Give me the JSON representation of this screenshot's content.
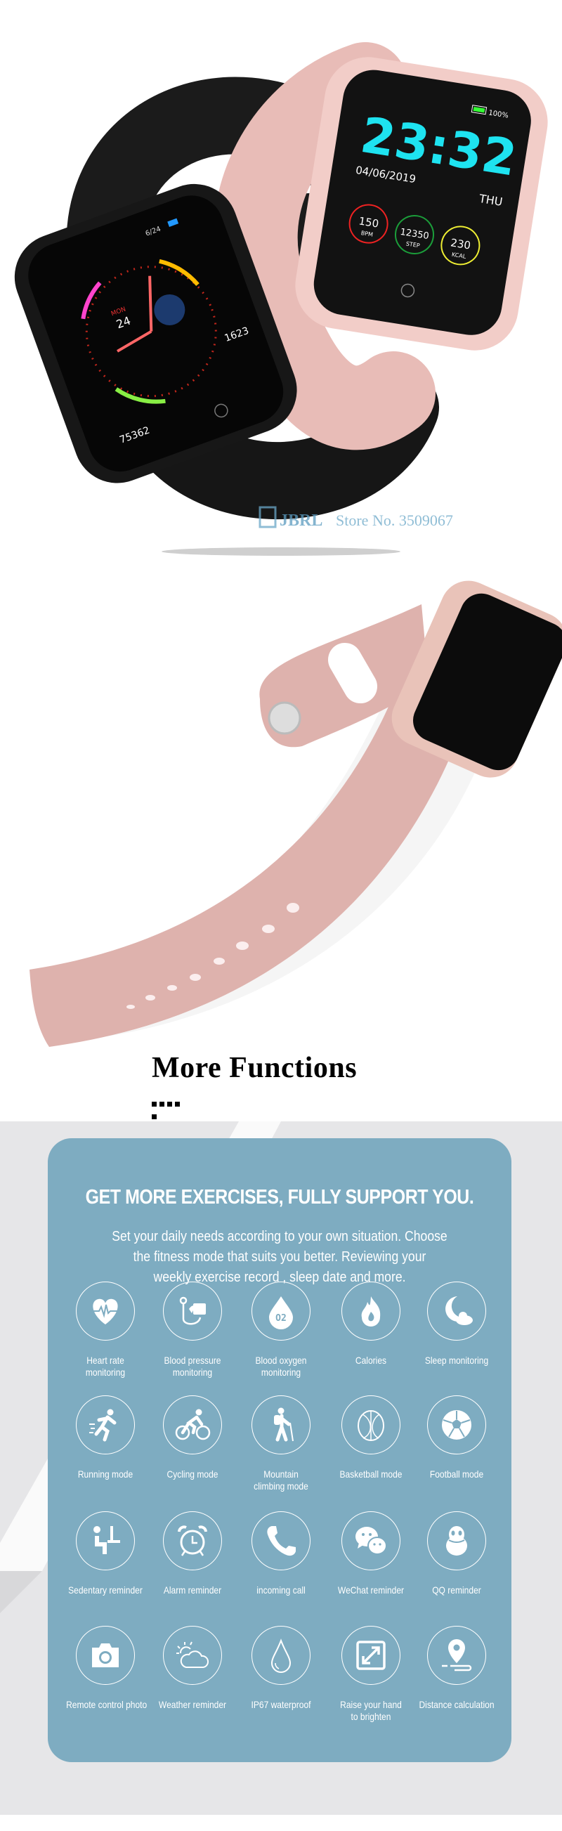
{
  "hero": {
    "pink_watch": {
      "time": "23:32",
      "date": "04/06/2019",
      "battery": "100%",
      "day": "THU",
      "heart": {
        "value": "150",
        "unit": "BPM"
      },
      "steps": {
        "value": "12350",
        "unit": "STEP"
      },
      "calories": {
        "value": "230",
        "unit": "KCAL"
      }
    },
    "black_watch": {
      "date": "6/24",
      "weekday": "MON",
      "day": "24",
      "calories": "1623",
      "steps": "75362"
    },
    "watermark": {
      "brand": "JBRL",
      "store": "Store No. 3509067"
    },
    "colors": {
      "pink_band": "#e8bcb7",
      "black_band": "#1b1b1b",
      "time_cyan": "#1ee3f0"
    }
  },
  "section": {
    "title": "More Functions",
    "dots": 5
  },
  "card": {
    "title": "GET MORE EXERCISES, FULLY SUPPORT YOU.",
    "subtitle_lines": [
      "Set your daily needs according to your own situation. Choose",
      "the fitness mode that suits you better. Reviewing your",
      "weekly exercise record , sleep date and more."
    ],
    "background": "#7eacc1",
    "features": [
      {
        "label": "Heart rate monitoring",
        "icon": "heart-rate-icon"
      },
      {
        "label": "Blood pressure monitoring",
        "icon": "blood-pressure-icon"
      },
      {
        "label": "Blood oxygen monitoring",
        "icon": "blood-oxygen-icon"
      },
      {
        "label": "Calories",
        "icon": "flame-icon"
      },
      {
        "label": "Sleep monitoring",
        "icon": "moon-cloud-icon"
      },
      {
        "label": "Running mode",
        "icon": "runner-icon"
      },
      {
        "label": "Cycling mode",
        "icon": "cyclist-icon"
      },
      {
        "label": "Mountain climbing mode",
        "icon": "hiker-icon"
      },
      {
        "label": "Basketball mode",
        "icon": "basketball-icon"
      },
      {
        "label": "Football mode",
        "icon": "football-icon"
      },
      {
        "label": "Sedentary reminder",
        "icon": "sedentary-icon"
      },
      {
        "label": "Alarm reminder",
        "icon": "alarm-clock-icon"
      },
      {
        "label": "incoming call",
        "icon": "phone-icon"
      },
      {
        "label": "WeChat reminder",
        "icon": "wechat-icon"
      },
      {
        "label": "QQ reminder",
        "icon": "qq-penguin-icon"
      },
      {
        "label": "Remote control photo",
        "icon": "camera-icon"
      },
      {
        "label": "Weather reminder",
        "icon": "weather-icon"
      },
      {
        "label": "IP67 waterproof",
        "icon": "water-drop-icon"
      },
      {
        "label": "Raise your hand to brighten",
        "icon": "expand-icon"
      },
      {
        "label": "Distance calculation",
        "icon": "location-pin-icon"
      }
    ]
  }
}
